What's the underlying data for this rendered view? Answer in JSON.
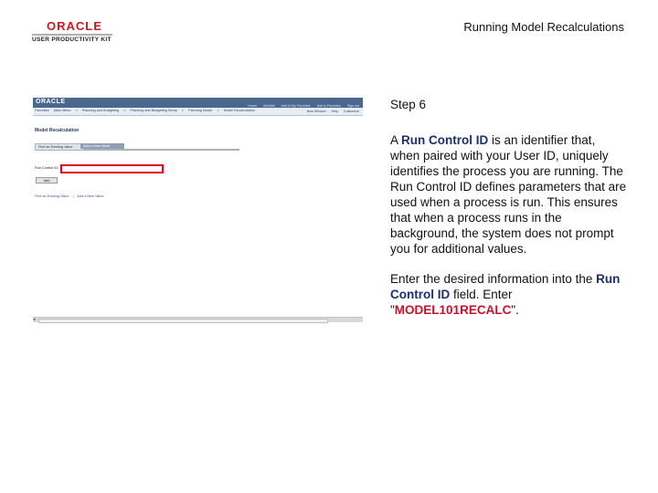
{
  "header": {
    "brand_name": "ORACLE",
    "brand_sub": "USER PRODUCTIVITY KIT",
    "doc_title": "Running Model Recalculations"
  },
  "screenshot": {
    "logo": "ORACLE",
    "top_links": [
      "Home",
      "Worklist",
      "Add to My Favorites",
      "Add to Favorites",
      "Sign out"
    ],
    "crumbs": [
      "Favorites",
      "Main Menu",
      ">",
      "Planning and Budgeting",
      ">",
      "Planning and Budgeting Setup",
      ">",
      "Planning Model",
      ">",
      "Model Recalculation"
    ],
    "tools": [
      "New Window",
      "Help",
      "Customize"
    ],
    "page_title": "Model Recalculation",
    "tabs": [
      "Find an Existing Value",
      "Add a New Value"
    ],
    "field_label": "Run Control ID:",
    "add_button": "Add",
    "bottom_links": [
      "Find an Existing Value",
      "|",
      "Add a New Value"
    ]
  },
  "instructions": {
    "step": "Step 6",
    "p1_pre": "A ",
    "p1_kw": "Run Control ID",
    "p1_post": " is an identifier that, when paired with your User ID, uniquely identifies the process you are running. The Run Control ID defines parameters that are used when a process is run. This ensures that when a process runs in the background, the system does not prompt you for additional values.",
    "p2_pre": "Enter the desired information into the ",
    "p2_kw": "Run Control ID",
    "p2_mid": " field. Enter \"",
    "p2_val": "MODEL101RECALC",
    "p2_post": "\"."
  },
  "colors": {
    "brand_red": "#d0161f",
    "header_blue": "#4a678d",
    "highlight_red": "#e2001a",
    "keyword_navy": "#1c2e6e"
  }
}
